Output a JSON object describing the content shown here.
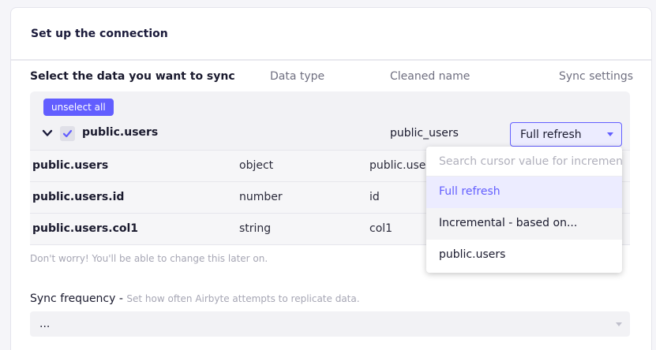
{
  "header": {
    "title": "Set up the connection"
  },
  "columns": {
    "select": "Select the data you want to sync",
    "data_type": "Data type",
    "cleaned_name": "Cleaned name",
    "sync_settings": "Sync settings"
  },
  "stream": {
    "unselect_label": "unselect all",
    "name": "public.users",
    "cleaned": "public_users",
    "sync_mode": "Full refresh",
    "checked": true
  },
  "fields": [
    {
      "name": "public.users",
      "type": "object",
      "cleaned": "public.users"
    },
    {
      "name": "public.users.id",
      "type": "number",
      "cleaned": "id"
    },
    {
      "name": "public.users.col1",
      "type": "string",
      "cleaned": "col1"
    }
  ],
  "hint": "Don't worry! You'll be able to change this later on.",
  "dropdown": {
    "search_placeholder": "Search cursor value for incremental",
    "options": [
      "Full refresh",
      "Incremental - based on...",
      "public.users"
    ],
    "selected_index": 0
  },
  "frequency": {
    "label": "Sync frequency",
    "separator": " - ",
    "description": "Set how often Airbyte attempts to replicate data.",
    "value": "..."
  },
  "colors": {
    "accent": "#625eff",
    "accent_bg": "#ececff"
  }
}
